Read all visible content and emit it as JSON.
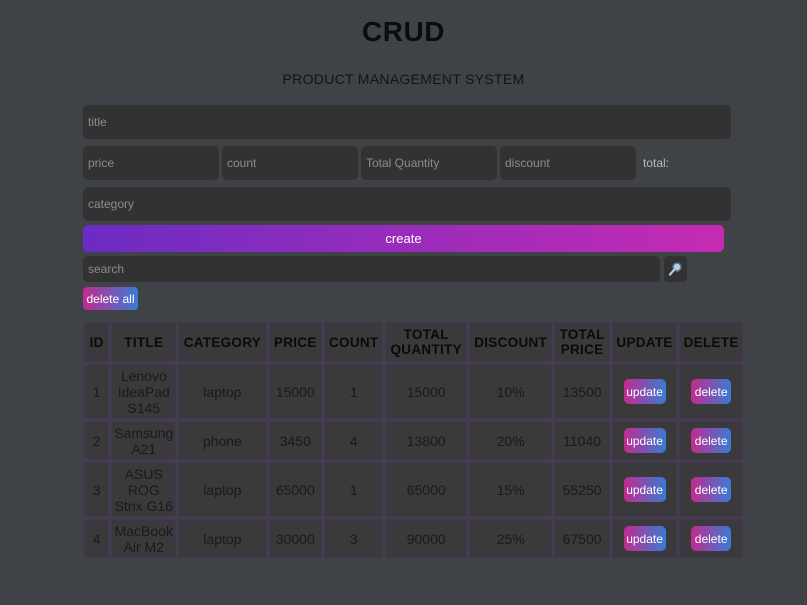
{
  "header": {
    "title": "CRUD",
    "subtitle": "PRODUCT MANAGEMENT SYSTEM"
  },
  "form": {
    "title_placeholder": "title",
    "price_placeholder": "price",
    "count_placeholder": "count",
    "total_quantity_placeholder": "Total Quantity",
    "discount_placeholder": "discount",
    "total_label": "total:",
    "category_placeholder": "category",
    "create_label": "create"
  },
  "search": {
    "placeholder": "search",
    "icon": "magnifier-icon"
  },
  "delete_all_label": "delete all",
  "table": {
    "headers": [
      "ID",
      "TITLE",
      "CATEGORY",
      "PRICE",
      "COUNT",
      "TOTAL QUANTITY",
      "DISCOUNT",
      "TOTAL PRICE",
      "UPDATE",
      "DELETE"
    ],
    "update_label": "update",
    "delete_label": "delete",
    "rows": [
      {
        "id": "1",
        "title": "Lenovo IdeaPad S145",
        "category": "laptop",
        "price": "15000",
        "count": "1",
        "total_quantity": "15000",
        "discount": "10%",
        "total_price": "13500"
      },
      {
        "id": "2",
        "title": "Samsung A21",
        "category": "phone",
        "price": "3450",
        "count": "4",
        "total_quantity": "13800",
        "discount": "20%",
        "total_price": "11040"
      },
      {
        "id": "3",
        "title": "ASUS ROG Strix G16",
        "category": "laptop",
        "price": "65000",
        "count": "1",
        "total_quantity": "65000",
        "discount": "15%",
        "total_price": "55250"
      },
      {
        "id": "4",
        "title": "MacBook Air M2",
        "category": "laptop",
        "price": "30000",
        "count": "3",
        "total_quantity": "90000",
        "discount": "25%",
        "total_price": "67500"
      }
    ]
  },
  "colors": {
    "background": "#3f4247",
    "input_bg": "#323232",
    "create_gradient": [
      "#6b2cc3",
      "#c52bb2"
    ],
    "button_gradient": [
      "#c12b8f",
      "#3a7bd5"
    ]
  }
}
